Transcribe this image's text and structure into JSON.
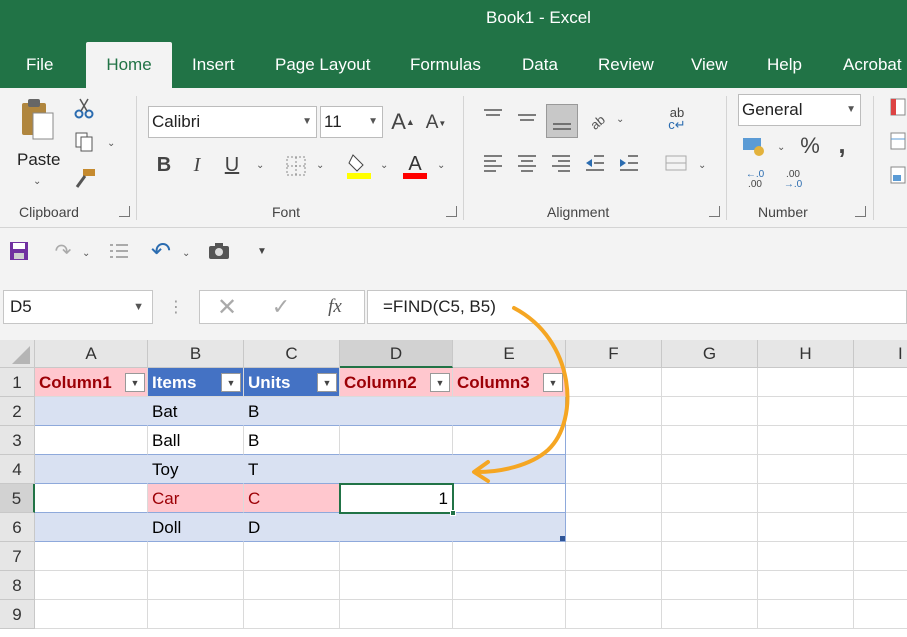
{
  "window": {
    "title": "Book1  -  Excel"
  },
  "tabs": [
    "File",
    "Home",
    "Insert",
    "Page Layout",
    "Formulas",
    "Data",
    "Review",
    "View",
    "Help",
    "Acrobat"
  ],
  "ribbon": {
    "clipboard": {
      "label": "Clipboard",
      "paste": "Paste"
    },
    "font": {
      "label": "Font",
      "name": "Calibri",
      "size": "11",
      "bold": "B",
      "italic": "I",
      "underline": "U",
      "fill_color": "#ffff00",
      "font_color": "#ff0000"
    },
    "alignment": {
      "label": "Alignment"
    },
    "number": {
      "label": "Number",
      "format": "General",
      "percent": "%",
      "comma": ","
    }
  },
  "formula_bar": {
    "name_box": "D5",
    "fx": "fx",
    "formula": "=FIND(C5, B5)"
  },
  "columns": [
    "A",
    "B",
    "C",
    "D",
    "E",
    "F",
    "G",
    "H",
    "I"
  ],
  "rows": [
    "1",
    "2",
    "3",
    "4",
    "5",
    "6",
    "7",
    "8",
    "9"
  ],
  "table": {
    "headers": [
      "Column1",
      "Items",
      "Units",
      "Column2",
      "Column3"
    ],
    "rows": [
      [
        "",
        "Bat",
        "B",
        "",
        ""
      ],
      [
        "",
        "Ball",
        "B",
        "",
        ""
      ],
      [
        "",
        "Toy",
        "T",
        "",
        ""
      ],
      [
        "",
        "Car",
        "C",
        "1",
        ""
      ],
      [
        "",
        "Doll",
        "D",
        "",
        ""
      ]
    ]
  },
  "colors": {
    "excel_green": "#217346",
    "band": "#d9e1f2",
    "header_blue": "#4472c4",
    "pink": "#ffc7ce",
    "dark_red": "#9c0006",
    "arrow": "#f5a623"
  }
}
